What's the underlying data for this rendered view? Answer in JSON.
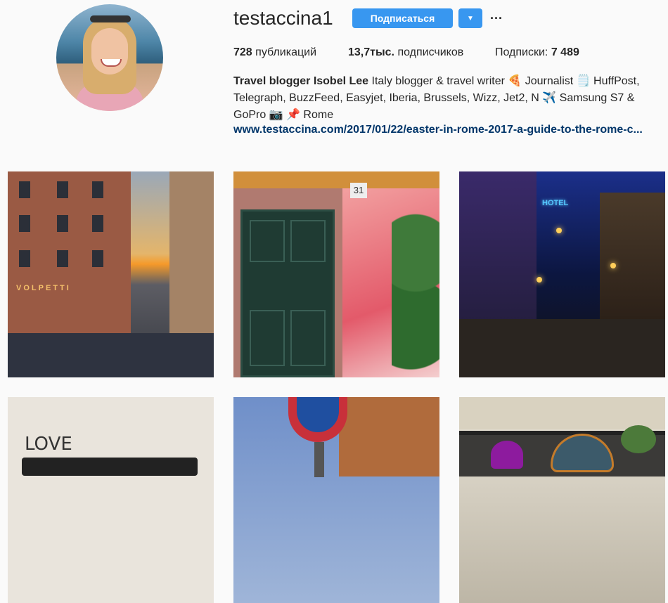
{
  "profile": {
    "username": "testaccina1",
    "follow_label": "Подписаться",
    "more_label": "···",
    "dropdown_label": "▼",
    "avatar_alt": "profile photo"
  },
  "stats": {
    "posts_count": "728",
    "posts_label": "публикаций",
    "followers_count": "13,7тыс.",
    "followers_label": "подписчиков",
    "following_label": "Подписки:",
    "following_count": "7 489"
  },
  "bio": {
    "name": "Travel blogger Isobel Lee",
    "text": " Italy blogger & travel writer 🍕 Journalist 🗒️ HuffPost, Telegraph, BuzzFeed, Easyjet, Iberia, Brussels, Wizz, Jet2, N ✈️ Samsung S7 & GoPro 📷 📌 Rome",
    "link": "www.testaccina.com/2017/01/22/easter-in-rome-2017-a-guide-to-the-rome-c..."
  },
  "posts": {
    "tile1_sign": "VOLPETTI",
    "tile2_number": "31",
    "tile3_neon": "HOTEL",
    "tile4_text": "LOVE"
  },
  "colors": {
    "primary": "#3897f0",
    "link": "#003569",
    "background": "#fafafa"
  }
}
